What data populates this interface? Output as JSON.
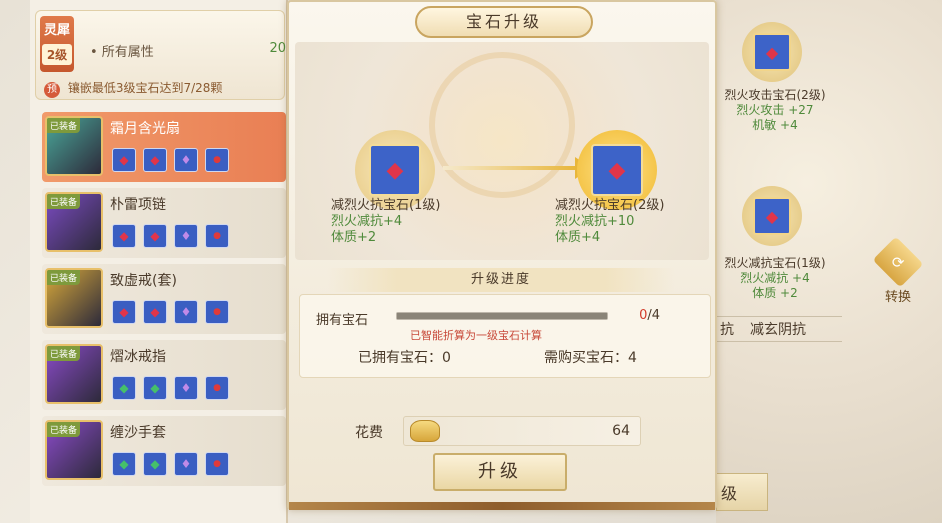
{
  "left": {
    "soul": {
      "badge": "灵犀",
      "level": "2级",
      "attr_label": "• 所有属性",
      "attr_value": "20",
      "req_icon": "预",
      "requirement": "镶嵌最低3级宝石达到7/28颗"
    },
    "equipment": [
      {
        "name": "霜月含光扇",
        "tag": "已装备",
        "selected": true,
        "gems": [
          "red",
          "red",
          "purple",
          "dot"
        ],
        "thumb_color": "#4aa89a"
      },
      {
        "name": "朴雷项链",
        "tag": "已装备",
        "selected": false,
        "gems": [
          "red",
          "red",
          "purple",
          "dot"
        ],
        "thumb_color": "#7b4bc2"
      },
      {
        "name": "致虚戒(套)",
        "tag": "已装备",
        "selected": false,
        "gems": [
          "red",
          "red",
          "purple",
          "dot"
        ],
        "thumb_color": "#d8a93a"
      },
      {
        "name": "熠冰戒指",
        "tag": "已装备",
        "selected": false,
        "gems": [
          "green",
          "green",
          "purple",
          "dot"
        ],
        "thumb_color": "#8a4bc8"
      },
      {
        "name": "缠沙手套",
        "tag": "已装备",
        "selected": false,
        "gems": [
          "green",
          "green",
          "purple",
          "dot"
        ],
        "thumb_color": "#8a4bc8"
      }
    ]
  },
  "modal": {
    "title": "宝石升级",
    "from_gem": {
      "name": "减烈火抗宝石(1级)",
      "line1": "烈火减抗+4",
      "line2": "体质+2"
    },
    "to_gem": {
      "name": "减烈火抗宝石(2级)",
      "line1": "烈火减抗+10",
      "line2": "体质+4"
    },
    "progress_title": "升级进度",
    "own_label": "拥有宝石",
    "progress_fraction": 1.0,
    "count_have": "0",
    "count_total": "/4",
    "note": "已智能折算为一级宝石计算",
    "owned_text": "已拥有宝石：0",
    "need_text": "需购买宝石：4",
    "cost_label": "花费",
    "cost_value": "64",
    "upgrade_button": "升级"
  },
  "right": {
    "gem1": {
      "name": "烈火攻击宝石(2级)",
      "line1": "烈火攻击 +27",
      "line2": "机敏 +4"
    },
    "gem2": {
      "name": "烈火减抗宝石(1级)",
      "line1": "烈火减抗 +4",
      "line2": "体质 +2"
    },
    "convert_label": "转换",
    "resist_1": "抗",
    "resist_2": "减玄阴抗",
    "bottom_button": "级"
  }
}
